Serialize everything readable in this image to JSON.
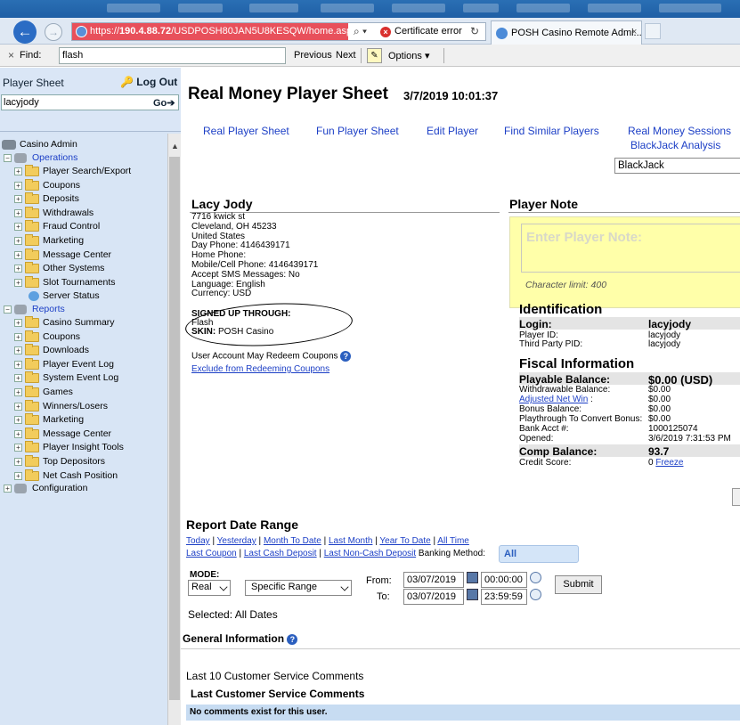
{
  "browser": {
    "url_host": "190.4.88.72",
    "url_rest": "/USDPOSH80JAN5U8KESQW/home.asp",
    "url_prefix": "https://",
    "cert_error": "Certificate error",
    "tab_title": "POSH Casino Remote Admi...",
    "find_label": "Find:",
    "find_value": "flash",
    "find_prev": "Previous",
    "find_next": "Next",
    "find_options": "Options ▾"
  },
  "sidebar": {
    "title": "Player Sheet",
    "logout": "Log Out",
    "search_value": "lacyjody",
    "go": "Go➔",
    "root": "Casino Admin",
    "operations": "Operations",
    "operations_items": [
      "Player Search/Export",
      "Coupons",
      "Deposits",
      "Withdrawals",
      "Fraud Control",
      "Marketing",
      "Message Center",
      "Other Systems",
      "Slot Tournaments",
      "Server Status"
    ],
    "reports": "Reports",
    "reports_items": [
      "Casino Summary",
      "Coupons",
      "Downloads",
      "Player Event Log",
      "System Event Log",
      "Games",
      "Winners/Losers",
      "Marketing",
      "Message Center",
      "Player Insight Tools",
      "Top Depositors",
      "Net Cash Position"
    ],
    "configuration": "Configuration"
  },
  "header": {
    "title": "Real Money Player Sheet",
    "date": "3/7/2019 10:01:37"
  },
  "nav": {
    "real_player_sheet": "Real Player Sheet",
    "fun_player_sheet": "Fun Player Sheet",
    "edit_player": "Edit Player",
    "find_similar": "Find Similar Players",
    "real_money_sessions": "Real Money Sessions",
    "blackjack_analysis": "BlackJack Analysis",
    "game_select": "BlackJack"
  },
  "player": {
    "name": "Lacy Jody",
    "street": "7716 kwick st",
    "city": "Cleveland, OH 45233",
    "country": "United States",
    "day_phone": "Day Phone: 4146439171",
    "home_phone": "Home Phone:",
    "mobile_phone": "Mobile/Cell Phone: 4146439171",
    "sms": "Accept SMS Messages: No",
    "language": "Language: English",
    "currency": "Currency: USD",
    "signed_up_label": "SIGNED UP THROUGH:",
    "signed_up_value": "Flash",
    "skin_label": "SKIN:",
    "skin_value": "POSH Casino",
    "redeem_text": "User Account May Redeem Coupons",
    "exclude_link": "Exclude from Redeeming Coupons"
  },
  "note": {
    "title": "Player Note",
    "placeholder": "Enter Player Note:",
    "limit": "Character limit: 400"
  },
  "identification": {
    "title": "Identification",
    "login_label": "Login:",
    "login_value": "lacyjody",
    "player_id_label": "Player ID:",
    "player_id_value": "lacyjody",
    "third_party_label": "Third Party PID:",
    "third_party_value": "lacyjody"
  },
  "fiscal": {
    "title": "Fiscal Information",
    "playable_label": "Playable Balance:",
    "playable_value": "$0.00 (USD)",
    "withdrawable_label": "Withdrawable Balance:",
    "withdrawable_value": "$0.00",
    "adjusted_label": "Adjusted Net Win",
    "adjusted_colon": " :",
    "adjusted_value": "$0.00",
    "bonus_label": "Bonus Balance:",
    "bonus_value": "$0.00",
    "playthrough_label": "Playthrough To Convert Bonus:",
    "playthrough_value": "$0.00",
    "bank_label": "Bank Acct #:",
    "bank_value": "1000125074",
    "opened_label": "Opened:",
    "opened_value": "3/6/2019 7:31:53 PM",
    "comp_label": "Comp Balance:",
    "comp_value": "93.7",
    "credit_label": "Credit Score:",
    "credit_value": "0",
    "freeze": "Freeze"
  },
  "report": {
    "title": "Report Date Range",
    "links1": [
      "Today",
      "Yesterday",
      "Month To Date",
      "Last Month",
      "Year To Date",
      "All Time"
    ],
    "links2": [
      "Last Coupon",
      "Last Cash Deposit",
      "Last Non-Cash Deposit"
    ],
    "banking_label": "Banking Method:",
    "banking_value": "All",
    "mode_label": "MODE:",
    "mode_value": "Real",
    "range_value": "Specific Range",
    "from_label": "From:",
    "to_label": "To:",
    "from_date": "03/07/2019",
    "from_time": "00:00:00",
    "to_date": "03/07/2019",
    "to_time": "23:59:59",
    "submit": "Submit",
    "selected": "Selected: All Dates"
  },
  "general": {
    "title": "General Information",
    "last_ten": "Last 10 Customer Service Comments",
    "last_comments_title": "Last Customer Service Comments",
    "no_comments": "No comments exist for this user."
  }
}
